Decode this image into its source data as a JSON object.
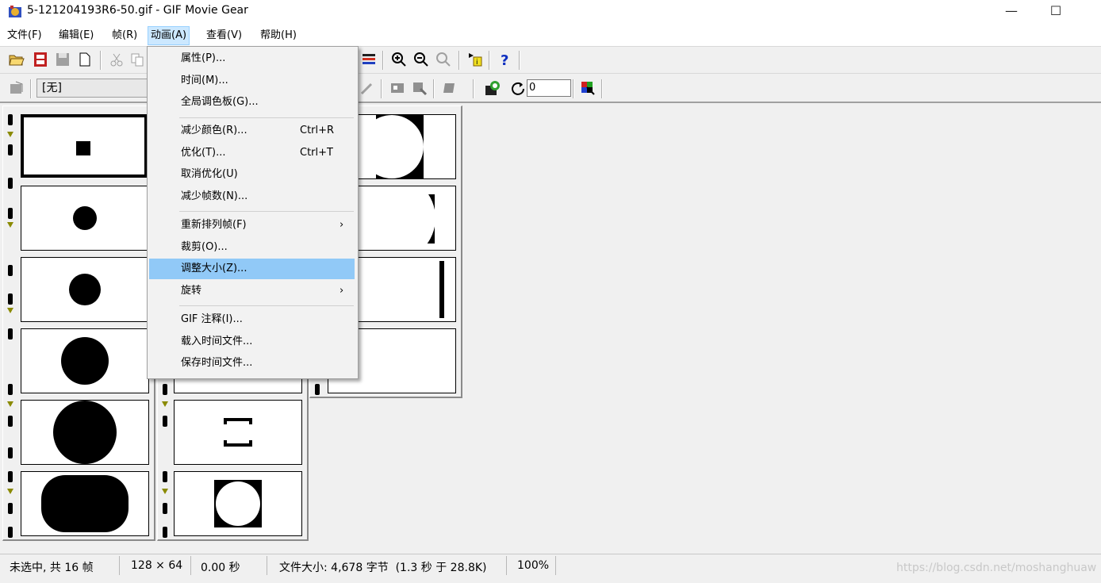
{
  "window": {
    "title": "5-121204193R6-50.gif - GIF Movie Gear",
    "minimize_glyph": "—",
    "maximize_glyph": "☐"
  },
  "menubar": {
    "items": [
      "文件(F)",
      "编辑(E)",
      "帧(R)",
      "动画(A)",
      "查看(V)",
      "帮助(H)"
    ],
    "active_index": 3
  },
  "toolbar2": {
    "combo_value": "[无]",
    "loop_value": "0"
  },
  "animation_menu": {
    "items": [
      {
        "label": "属性(P)...",
        "shortcut": "",
        "submenu": false
      },
      {
        "label": "时间(M)...",
        "shortcut": "",
        "submenu": false
      },
      {
        "label": "全局调色板(G)...",
        "shortcut": "",
        "submenu": false
      },
      {
        "label": "减少颜色(R)...",
        "shortcut": "Ctrl+R",
        "submenu": false
      },
      {
        "label": "优化(T)...",
        "shortcut": "Ctrl+T",
        "submenu": false
      },
      {
        "label": "取消优化(U)",
        "shortcut": "",
        "submenu": false
      },
      {
        "label": "减少帧数(N)...",
        "shortcut": "",
        "submenu": false
      },
      {
        "label": "重新排列帧(F)",
        "shortcut": "",
        "submenu": true
      },
      {
        "label": "裁剪(O)...",
        "shortcut": "",
        "submenu": false
      },
      {
        "label": "调整大小(Z)...",
        "shortcut": "",
        "submenu": false,
        "highlighted": true
      },
      {
        "label": "旋转",
        "shortcut": "",
        "submenu": true
      },
      {
        "label": "GIF 注释(I)...",
        "shortcut": "",
        "submenu": false
      },
      {
        "label": "载入时间文件...",
        "shortcut": "",
        "submenu": false
      },
      {
        "label": "保存时间文件...",
        "shortcut": "",
        "submenu": false
      }
    ],
    "submenu_arrow": "›"
  },
  "frames": {
    "count": 16,
    "selected_index": 0,
    "thumb_colors": {
      "fill": "#000000",
      "bg": "#ffffff"
    }
  },
  "statusbar": {
    "selection": "未选中, 共 16 帧",
    "dimensions": "128 × 64",
    "duration": "0.00 秒",
    "file_size": "文件大小: 4,678 字节  (1.3 秒 于 28.8K)",
    "zoom": "100%"
  },
  "watermark": "https://blog.csdn.net/moshanghuaw"
}
